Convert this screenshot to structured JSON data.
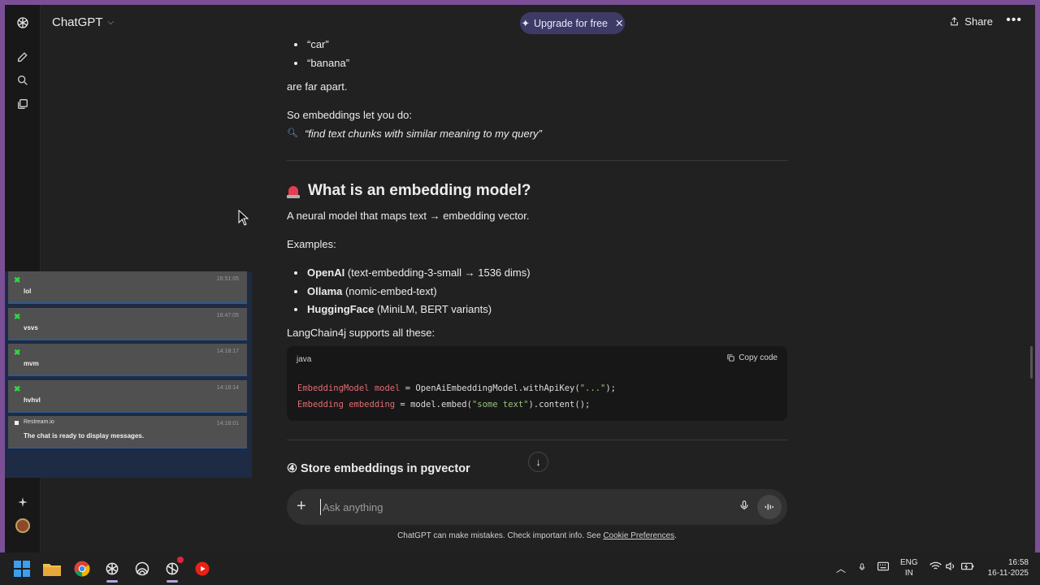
{
  "header": {
    "app_name": "ChatGPT",
    "upgrade_label": "Upgrade for free",
    "share_label": "Share"
  },
  "content": {
    "list_top": [
      "“car”",
      "“banana”"
    ],
    "far_apart": "are far apart.",
    "so_embeddings": "So embeddings let you do:",
    "query_quote": "“find text chunks with similar meaning to my query”",
    "section_title": "What is an embedding model?",
    "model_desc": "A neural model that maps text → embedding vector.",
    "examples_label": "Examples:",
    "examples": [
      {
        "bold": "OpenAI",
        "rest": " (text-embedding-3-small → 1536 dims)"
      },
      {
        "bold": "Ollama",
        "rest": " (nomic-embed-text)"
      },
      {
        "bold": "HuggingFace",
        "rest": " (MiniLM, BERT variants)"
      }
    ],
    "supports": "LangChain4j supports all these:",
    "code_lang": "java",
    "copy_label": "Copy code",
    "next_section": "④ Store embeddings in pgvector"
  },
  "overlay_chat": {
    "messages": [
      {
        "time": "16:51:05",
        "text": "lol"
      },
      {
        "time": "16:47:05",
        "text": "vsvs"
      },
      {
        "time": "14:18:17",
        "text": "mvm"
      },
      {
        "time": "14:18:14",
        "text": "hvhvl"
      }
    ],
    "system": {
      "source": "Restream.io",
      "time": "14:18:01",
      "text": "The chat is ready to display messages."
    }
  },
  "composer": {
    "placeholder": "Ask anything"
  },
  "footer": {
    "disclaimer": "ChatGPT can make mistakes. Check important info. See ",
    "cookie_link": "Cookie Preferences",
    "period": "."
  },
  "taskbar": {
    "lang_top": "ENG",
    "lang_bottom": "IN",
    "time": "16:58",
    "date": "16-11-2025"
  },
  "colors": {
    "frame": "#7b4f96",
    "background": "#212121",
    "code_keyword": "#e06c75",
    "code_string": "#98c379",
    "chat_badge": "#31d843"
  }
}
